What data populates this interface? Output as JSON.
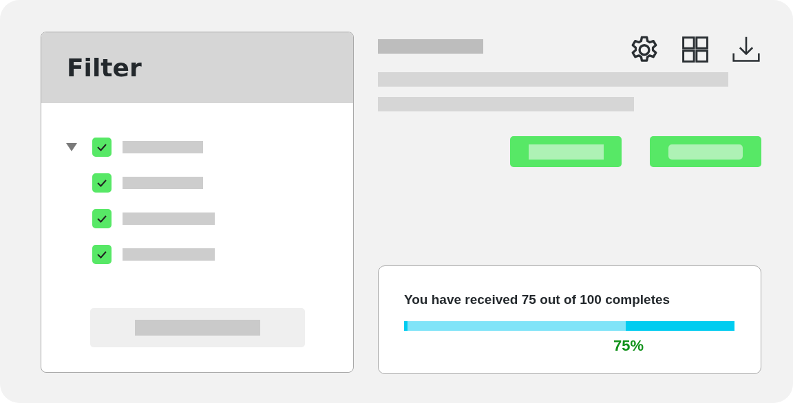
{
  "filter": {
    "title": "Filter",
    "items": [
      {
        "checked": true,
        "expanded": true,
        "children": [
          {
            "checked": true
          },
          {
            "checked": true
          },
          {
            "checked": true
          }
        ]
      }
    ]
  },
  "progress": {
    "message": "You have received 75 out of 100 completes",
    "level": 0.66,
    "percent": "75%"
  }
}
